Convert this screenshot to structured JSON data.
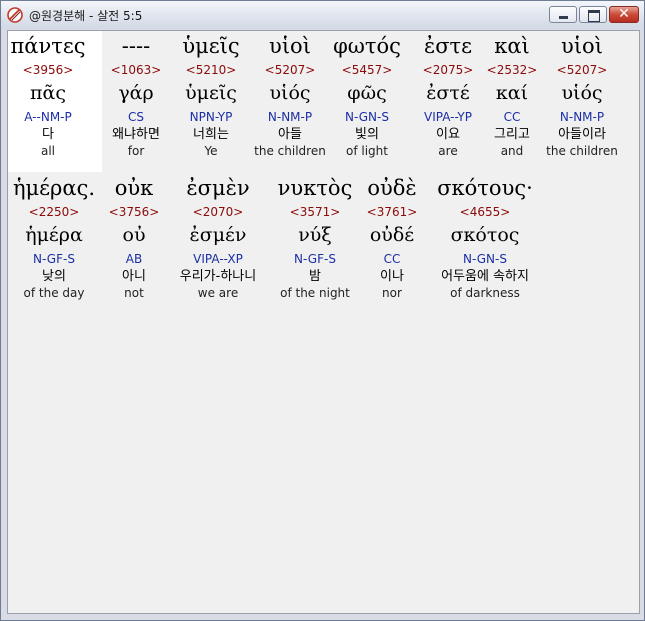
{
  "window": {
    "title": "@원경분해 - 살전 5:5"
  },
  "rows": [
    {
      "words": [
        {
          "greek": "πάντες",
          "strong": "<3956>",
          "lemma": "πᾶς",
          "parse": "A--NM-P",
          "korean": "다",
          "english": "all"
        },
        {
          "greek": "----",
          "strong": "<1063>",
          "lemma": "γάρ",
          "parse": "CS",
          "korean": "왜냐하면",
          "english": "for"
        },
        {
          "greek": "ὑμεῖς",
          "strong": "<5210>",
          "lemma": "ὑμεῖς",
          "parse": "NPN-YP",
          "korean": "너희는",
          "english": "Ye"
        },
        {
          "greek": "υἱοὶ",
          "strong": "<5207>",
          "lemma": "υἱός",
          "parse": "N-NM-P",
          "korean": "아들",
          "english": "the children"
        },
        {
          "greek": "φωτός",
          "strong": "<5457>",
          "lemma": "φῶς",
          "parse": "N-GN-S",
          "korean": "빛의",
          "english": "of light"
        },
        {
          "greek": "ἐστε",
          "strong": "<2075>",
          "lemma": "ἐστέ",
          "parse": "VIPA--YP",
          "korean": "이요",
          "english": "are"
        },
        {
          "greek": "καὶ",
          "strong": "<2532>",
          "lemma": "καί",
          "parse": "CC",
          "korean": "그리고",
          "english": "and"
        },
        {
          "greek": "υἱοὶ",
          "strong": "<5207>",
          "lemma": "υἱός",
          "parse": "N-NM-P",
          "korean": "아들이라",
          "english": "the children"
        }
      ]
    },
    {
      "words": [
        {
          "greek": "ἡμέρας.",
          "strong": "<2250>",
          "lemma": "ἡμέρα",
          "parse": "N-GF-S",
          "korean": "낮의",
          "english": "of the day"
        },
        {
          "greek": "οὐκ",
          "strong": "<3756>",
          "lemma": "οὐ",
          "parse": "AB",
          "korean": "아니",
          "english": "not"
        },
        {
          "greek": "ἐσμὲν",
          "strong": "<2070>",
          "lemma": "ἐσμέν",
          "parse": "VIPA--XP",
          "korean": "우리가-하나니",
          "english": "we are"
        },
        {
          "greek": "νυκτὸς",
          "strong": "<3571>",
          "lemma": "νύξ",
          "parse": "N-GF-S",
          "korean": "밤",
          "english": "of the night"
        },
        {
          "greek": "οὐδὲ",
          "strong": "<3761>",
          "lemma": "οὐδέ",
          "parse": "CC",
          "korean": "이나",
          "english": "nor"
        },
        {
          "greek": "σκότους·",
          "strong": "<4655>",
          "lemma": "σκότος",
          "parse": "N-GN-S",
          "korean": "어두움에 속하지",
          "english": "of darkness"
        }
      ]
    }
  ]
}
